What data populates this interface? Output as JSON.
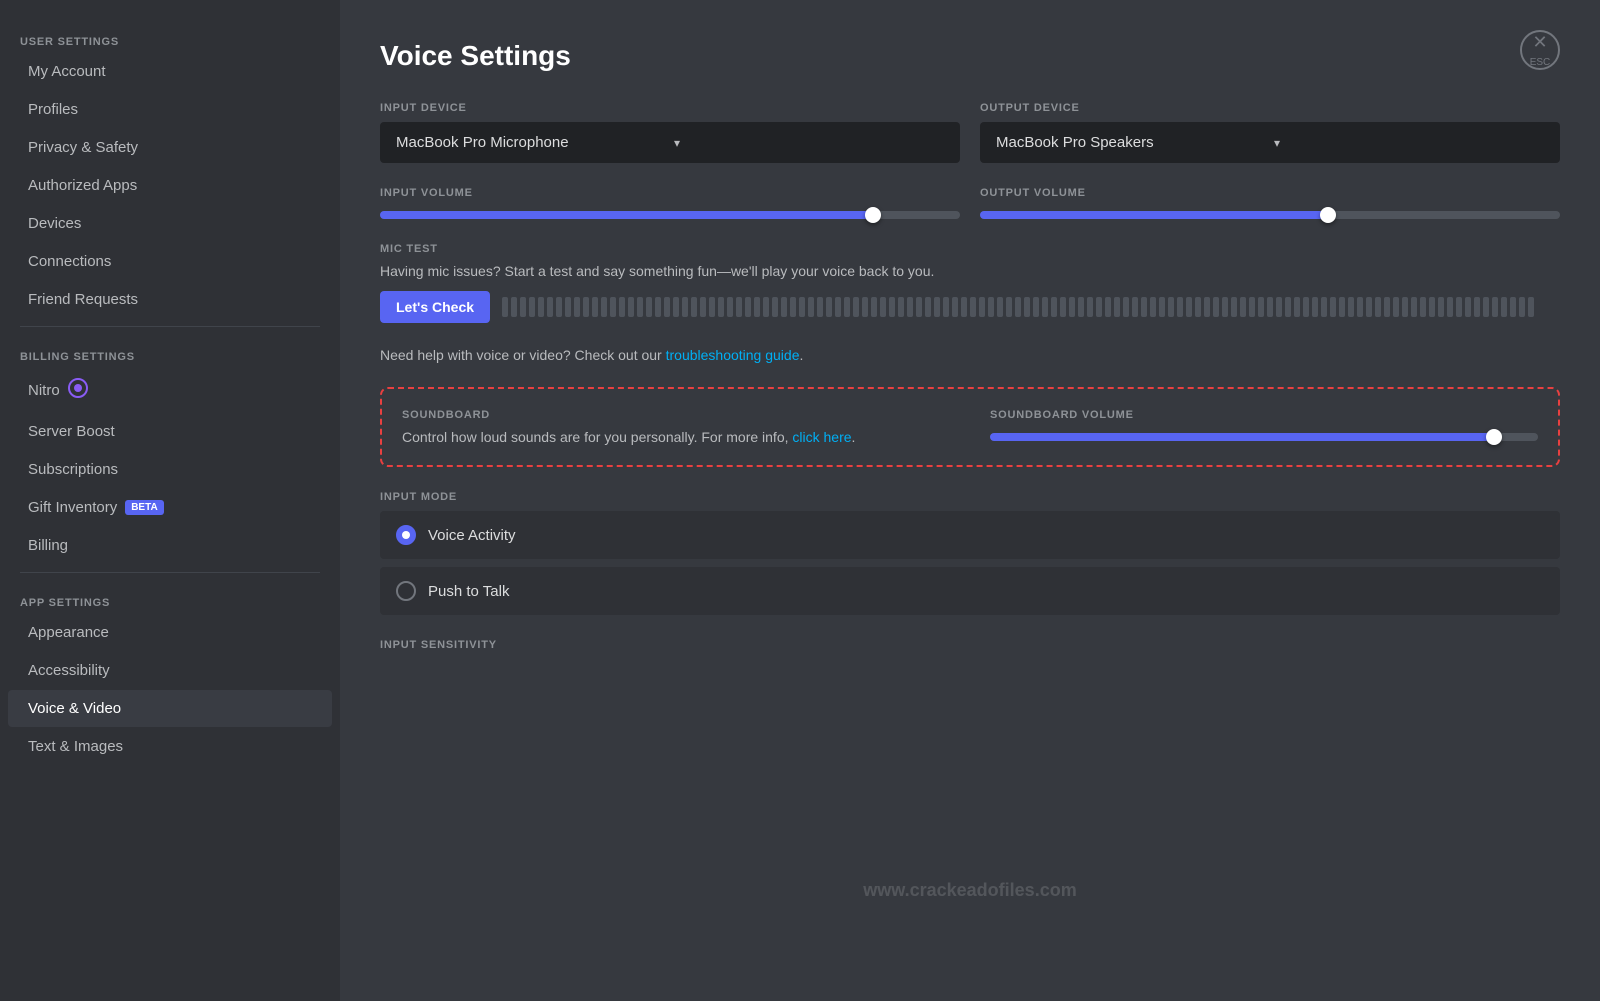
{
  "sidebar": {
    "user_settings_label": "USER SETTINGS",
    "billing_settings_label": "BILLING SETTINGS",
    "app_settings_label": "APP SETTINGS",
    "items": {
      "my_account": "My Account",
      "profiles": "Profiles",
      "privacy_safety": "Privacy & Safety",
      "authorized_apps": "Authorized Apps",
      "devices": "Devices",
      "connections": "Connections",
      "friend_requests": "Friend Requests",
      "nitro": "Nitro",
      "server_boost": "Server Boost",
      "subscriptions": "Subscriptions",
      "gift_inventory": "Gift Inventory",
      "gift_inventory_badge": "BETA",
      "billing": "Billing",
      "appearance": "Appearance",
      "accessibility": "Accessibility",
      "voice_video": "Voice & Video",
      "text_images": "Text & Images"
    }
  },
  "main": {
    "title": "Voice Settings",
    "input_device_label": "INPUT DEVICE",
    "input_device_value": "MacBook Pro Microphone",
    "output_device_label": "OUTPUT DEVICE",
    "output_device_value": "MacBook Pro Speakers",
    "input_volume_label": "INPUT VOLUME",
    "output_volume_label": "OUTPUT VOLUME",
    "mic_test_label": "MIC TEST",
    "mic_test_desc": "Having mic issues? Start a test and say something fun—we'll play your voice back to you.",
    "lets_check_btn": "Let's Check",
    "help_text_prefix": "Need help with voice or video? Check out our ",
    "help_text_link": "troubleshooting guide",
    "help_text_suffix": ".",
    "soundboard_label": "SOUNDBOARD",
    "soundboard_volume_label": "SOUNDBOARD VOLUME",
    "soundboard_desc_prefix": "Control how loud sounds are for you personally. For more info, ",
    "soundboard_link": "click here",
    "soundboard_desc_suffix": ".",
    "input_mode_label": "INPUT MODE",
    "voice_activity_label": "Voice Activity",
    "push_to_talk_label": "Push to Talk",
    "input_sensitivity_label": "INPUT SENSITIVITY",
    "close_label": "✕",
    "esc_label": "ESC",
    "watermark": "www.crackeadofiles.com"
  }
}
